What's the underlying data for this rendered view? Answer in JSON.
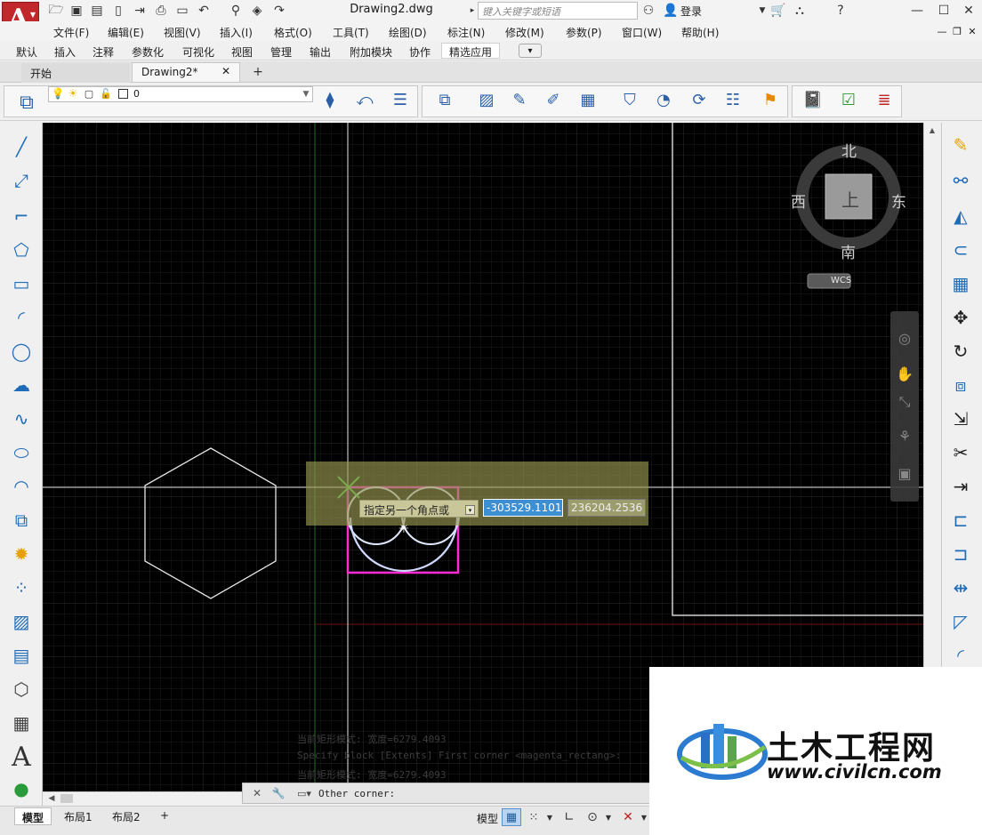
{
  "title_bar": {
    "doc_title": "Drawing2.dwg",
    "search_placeholder": "键入关键字或短语",
    "login_label": "登录"
  },
  "menu": [
    "文件(F)",
    "编辑(E)",
    "视图(V)",
    "插入(I)",
    "格式(O)",
    "工具(T)",
    "绘图(D)",
    "标注(N)",
    "修改(M)",
    "参数(P)",
    "窗口(W)",
    "帮助(H)"
  ],
  "ribbon_tabs": [
    "默认",
    "插入",
    "注释",
    "参数化",
    "可视化",
    "视图",
    "管理",
    "输出",
    "附加模块",
    "协作",
    "精选应用"
  ],
  "ribbon_active_tab": "精选应用",
  "doc_tabs": {
    "start": "开始",
    "drawing": "Drawing2*",
    "add": "+"
  },
  "layer": {
    "current": "0"
  },
  "viewcube": {
    "north": "北",
    "south": "南",
    "east": "东",
    "west": "西",
    "top_face": "上",
    "ucs": "WCS"
  },
  "dynamic_input": {
    "prompt": "指定另一个角点或",
    "x_value": "-303529.1101",
    "y_value": "236204.2536"
  },
  "command_history": [
    "当前矩形模式:  宽度=6279.4093",
    "Specify block [Extents] First corner <magenta_rectang>:",
    "当前矩形模式:  宽度=6279.4093"
  ],
  "command_line": "Other corner:",
  "layout_tabs": [
    "模型",
    "布局1",
    "布局2",
    "+"
  ],
  "status": {
    "model_label": "模型"
  },
  "watermark": {
    "title": "土木工程网",
    "url": "www.civilcn.com"
  },
  "colors": {
    "canvas": "#000000",
    "rect": "#ff2ad4",
    "hexagon": "#e6e6e6",
    "accent": "#2b7bd1",
    "crosshair": "#44d244"
  }
}
